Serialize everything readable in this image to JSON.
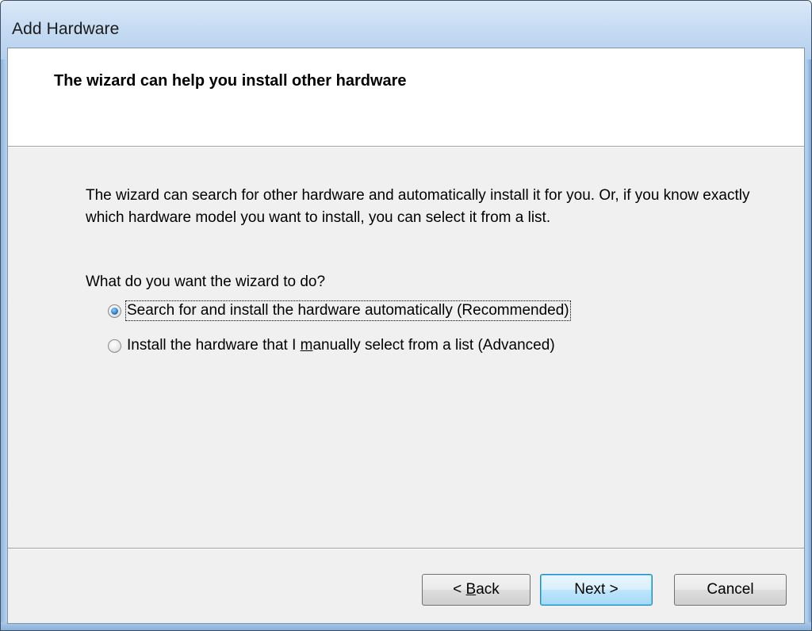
{
  "window": {
    "title": "Add Hardware"
  },
  "header": {
    "title": "The wizard can help you install other hardware"
  },
  "body": {
    "description": "The wizard can search for other hardware and automatically install it for you. Or, if you know exactly which hardware model you want to install, you can select it from a list.",
    "question": "What do you want the wizard to do?",
    "options": [
      {
        "label": "Search for and install the hardware automatically (Recommended)",
        "selected": true
      },
      {
        "label_before": "Install the hardware that I ",
        "label_accel": "m",
        "label_after": "anually select from a list (Advanced)",
        "selected": false
      }
    ]
  },
  "buttons": {
    "back_prefix": "< ",
    "back_accel": "B",
    "back_rest": "ack",
    "next": "Next >",
    "cancel": "Cancel"
  }
}
